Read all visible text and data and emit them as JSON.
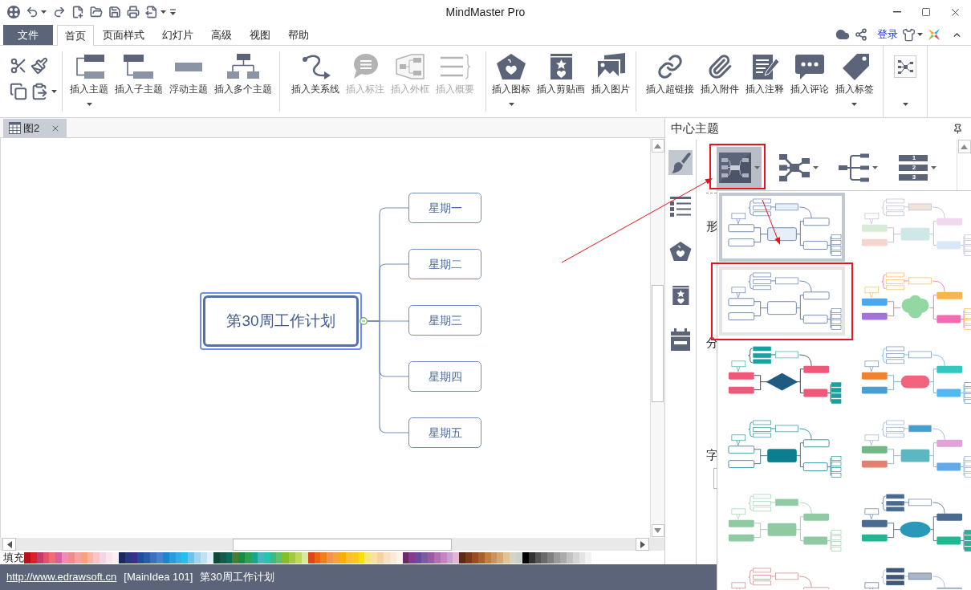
{
  "window": {
    "title": "MindMaster Pro"
  },
  "menu": {
    "file": "文件",
    "tabs": [
      {
        "label": "首页",
        "selected": true
      },
      {
        "label": "页面样式",
        "selected": false
      },
      {
        "label": "幻灯片",
        "selected": false
      },
      {
        "label": "高级",
        "selected": false
      },
      {
        "label": "视图",
        "selected": false
      },
      {
        "label": "帮助",
        "selected": false
      }
    ],
    "login": "登录"
  },
  "ribbon": {
    "groups": [
      {
        "buttons": [
          {
            "label": "插入主题",
            "dropdown": true,
            "disabled": false
          },
          {
            "label": "插入子主题",
            "dropdown": false,
            "disabled": false
          },
          {
            "label": "浮动主题",
            "dropdown": false,
            "disabled": false
          },
          {
            "label": "插入多个主题",
            "dropdown": false,
            "disabled": false
          }
        ]
      },
      {
        "buttons": [
          {
            "label": "插入关系线",
            "dropdown": false,
            "disabled": false
          },
          {
            "label": "插入标注",
            "dropdown": false,
            "disabled": true
          },
          {
            "label": "插入外框",
            "dropdown": false,
            "disabled": true
          },
          {
            "label": "插入概要",
            "dropdown": false,
            "disabled": true
          }
        ]
      },
      {
        "buttons": [
          {
            "label": "插入图标",
            "dropdown": true,
            "disabled": false
          },
          {
            "label": "插入剪贴画",
            "dropdown": false,
            "disabled": false
          },
          {
            "label": "插入图片",
            "dropdown": false,
            "disabled": false
          }
        ]
      },
      {
        "buttons": [
          {
            "label": "插入超链接",
            "dropdown": false,
            "disabled": false
          },
          {
            "label": "插入附件",
            "dropdown": false,
            "disabled": false
          },
          {
            "label": "插入注释",
            "dropdown": false,
            "disabled": false
          },
          {
            "label": "插入评论",
            "dropdown": false,
            "disabled": false
          },
          {
            "label": "插入标签",
            "dropdown": true,
            "disabled": false
          }
        ]
      },
      {
        "buttons": [
          {
            "dropdown": true,
            "disabled": false
          }
        ]
      }
    ]
  },
  "document_tabs": [
    {
      "label": "图2",
      "selected": true
    }
  ],
  "canvas": {
    "central_topic": {
      "text": "第30周工作计划",
      "selected": true
    },
    "topics": [
      {
        "text": "星期一"
      },
      {
        "text": "星期二"
      },
      {
        "text": "星期三"
      },
      {
        "text": "星期四"
      },
      {
        "text": "星期五"
      }
    ]
  },
  "palette": {
    "label": "填充",
    "swatches": [
      {
        "color": "#b5121b"
      },
      {
        "color": "#e02027"
      },
      {
        "color": "#c43c6c"
      },
      {
        "color": "#e4506e"
      },
      {
        "color": "#ec6d74"
      },
      {
        "color": "#d9609e"
      },
      {
        "color": "#ee8fb0"
      },
      {
        "color": "#f08b8b"
      },
      {
        "color": "#f5a3a0"
      },
      {
        "color": "#f7a27d"
      },
      {
        "color": "#f9b6a3"
      },
      {
        "color": "#f8c6c4"
      },
      {
        "color": "#f3d6e3"
      },
      {
        "color": "#fbe4ee"
      },
      {
        "color": "#fdf0f4"
      },
      {
        "color": "#1b2a5c"
      },
      {
        "color": "#27387e"
      },
      {
        "color": "#3b2f8e"
      },
      {
        "color": "#1f4e9e"
      },
      {
        "color": "#2b5aa8"
      },
      {
        "color": "#3f6fbf"
      },
      {
        "color": "#4a82cf"
      },
      {
        "color": "#1a86cf"
      },
      {
        "color": "#2a9be0"
      },
      {
        "color": "#33aee8"
      },
      {
        "color": "#22c0f0"
      },
      {
        "color": "#6ec3ee"
      },
      {
        "color": "#9fd3f0"
      },
      {
        "color": "#bfe2f3"
      },
      {
        "color": "#dff0f8"
      },
      {
        "color": "#0b4a3b"
      },
      {
        "color": "#18594a"
      },
      {
        "color": "#0d6b5c"
      },
      {
        "color": "#4d7a35"
      },
      {
        "color": "#178a48"
      },
      {
        "color": "#2ba24f"
      },
      {
        "color": "#1aa68d"
      },
      {
        "color": "#46b6c0"
      },
      {
        "color": "#22c6ae"
      },
      {
        "color": "#3fb87e"
      },
      {
        "color": "#62c06c"
      },
      {
        "color": "#84c023"
      },
      {
        "color": "#a3c93f"
      },
      {
        "color": "#bcd95e"
      },
      {
        "color": "#d5e9a2"
      },
      {
        "color": "#e0451a"
      },
      {
        "color": "#ee6416"
      },
      {
        "color": "#f07f1e"
      },
      {
        "color": "#f2944d"
      },
      {
        "color": "#f6a33c"
      },
      {
        "color": "#f7b000"
      },
      {
        "color": "#f8bf2e"
      },
      {
        "color": "#f9c91c"
      },
      {
        "color": "#f9e000"
      },
      {
        "color": "#f8e96e"
      },
      {
        "color": "#f7e2a3"
      },
      {
        "color": "#f6d2a0"
      },
      {
        "color": "#f8e0c2"
      },
      {
        "color": "#fbe9d3"
      },
      {
        "color": "#fdf3e6"
      },
      {
        "color": "#6b2a6b"
      },
      {
        "color": "#873a8c"
      },
      {
        "color": "#6a4a9b"
      },
      {
        "color": "#7b5ba2"
      },
      {
        "color": "#9a5ba2"
      },
      {
        "color": "#b070b3"
      },
      {
        "color": "#c583c4"
      },
      {
        "color": "#c4a3d4"
      },
      {
        "color": "#e3b6d6"
      },
      {
        "color": "#5c2a1a"
      },
      {
        "color": "#7a3b1c"
      },
      {
        "color": "#9a4b22"
      },
      {
        "color": "#a5622c"
      },
      {
        "color": "#c17f3f"
      },
      {
        "color": "#c9925f"
      },
      {
        "color": "#d5a774"
      },
      {
        "color": "#e0c495"
      },
      {
        "color": "#d6d2c4"
      },
      {
        "color": "#c9d2ca"
      },
      {
        "color": "#000000"
      },
      {
        "color": "#333333"
      },
      {
        "color": "#555555"
      },
      {
        "color": "#6b6b6b"
      },
      {
        "color": "#808080"
      },
      {
        "color": "#9a9a9a"
      },
      {
        "color": "#ababab"
      },
      {
        "color": "#c2c2c2"
      },
      {
        "color": "#d4d4d4"
      },
      {
        "color": "#e4e4e4"
      },
      {
        "color": "#f2f2f2"
      }
    ]
  },
  "right_panel": {
    "title": "中心主题",
    "side_tabs": [
      {
        "selected": true
      },
      {
        "selected": false
      },
      {
        "selected": false
      },
      {
        "selected": false
      },
      {
        "selected": false
      }
    ],
    "layouts": [
      {
        "selected": true,
        "dropdown": true
      },
      {
        "selected": false,
        "dropdown": true
      },
      {
        "selected": false,
        "dropdown": true
      },
      {
        "selected": false,
        "dropdown": true,
        "numbers": [
          "1",
          "2",
          "3"
        ]
      }
    ],
    "section_labels": [
      "形",
      "分",
      "字"
    ]
  },
  "theme_gallery": {
    "themes": [
      {
        "selected": true,
        "hovered": false
      },
      {
        "selected": false,
        "hovered": false
      },
      {
        "selected": false,
        "hovered": true
      },
      {
        "selected": false,
        "hovered": false
      },
      {
        "selected": false,
        "hovered": false
      },
      {
        "selected": false,
        "hovered": false
      },
      {
        "selected": false,
        "hovered": false
      },
      {
        "selected": false,
        "hovered": false
      },
      {
        "selected": false,
        "hovered": false
      },
      {
        "selected": false,
        "hovered": false
      },
      {
        "selected": false,
        "hovered": false
      },
      {
        "selected": false,
        "hovered": false
      }
    ]
  },
  "status_bar": {
    "link": "http://www.edrawsoft.cn",
    "items": [
      "[MainIdea 101]",
      "第30周工作计划"
    ]
  }
}
